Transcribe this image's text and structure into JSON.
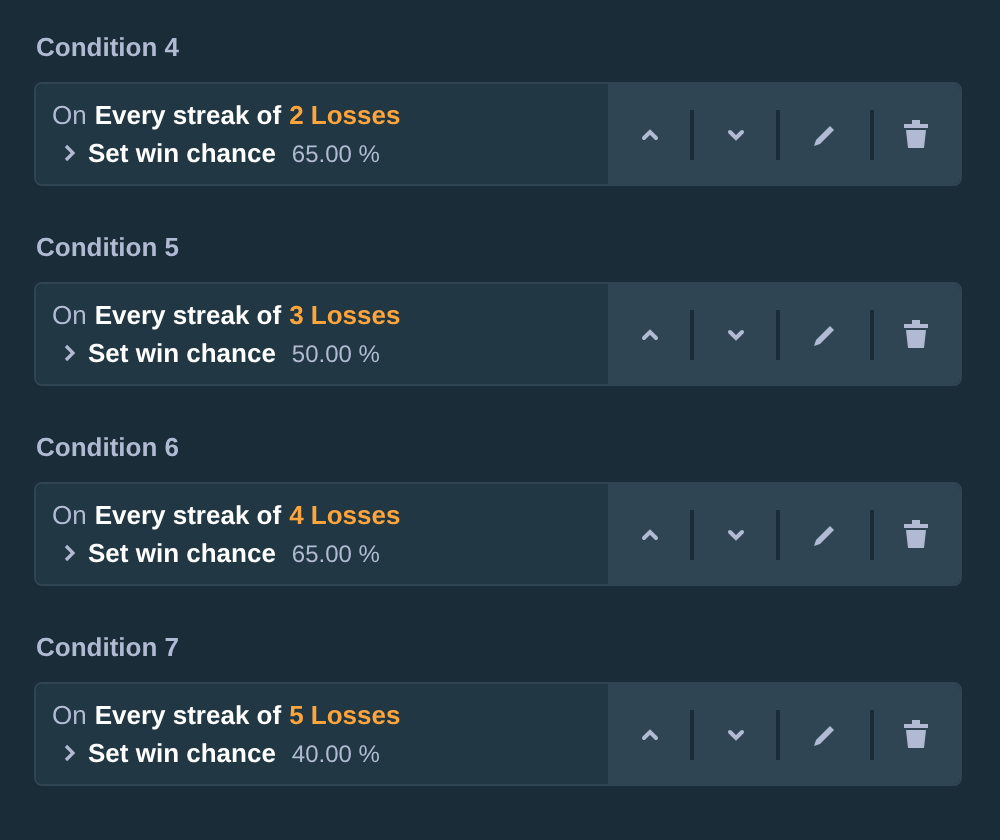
{
  "conditions": [
    {
      "title": "Condition 4",
      "on": "On",
      "trigger": "Every streak of",
      "count": "2 Losses",
      "action": "Set win chance",
      "value": "65.00 %"
    },
    {
      "title": "Condition 5",
      "on": "On",
      "trigger": "Every streak of",
      "count": "3 Losses",
      "action": "Set win chance",
      "value": "50.00 %"
    },
    {
      "title": "Condition 6",
      "on": "On",
      "trigger": "Every streak of",
      "count": "4 Losses",
      "action": "Set win chance",
      "value": "65.00 %"
    },
    {
      "title": "Condition 7",
      "on": "On",
      "trigger": "Every streak of",
      "count": "5 Losses",
      "action": "Set win chance",
      "value": "40.00 %"
    }
  ]
}
